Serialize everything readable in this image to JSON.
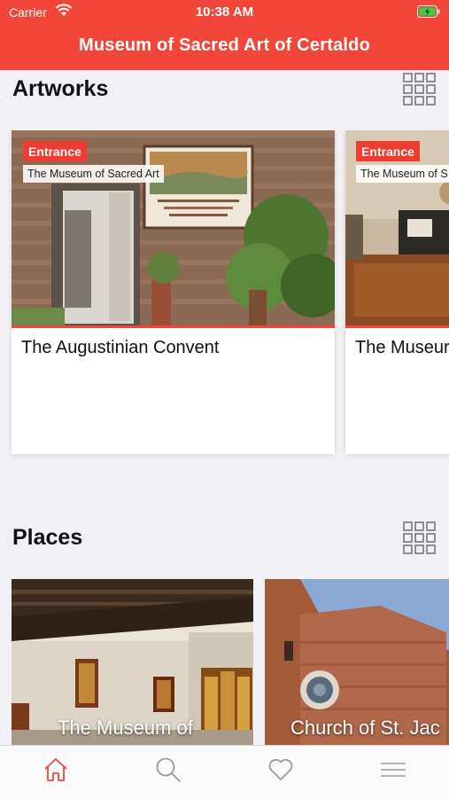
{
  "status_bar": {
    "carrier": "Carrier",
    "time": "10:38 AM"
  },
  "nav": {
    "title": "Museum of Sacred Art of Certaldo"
  },
  "artworks": {
    "title": "Artworks",
    "cards": [
      {
        "category": "Entrance",
        "location": "The Museum of Sacred Art",
        "title": "The Augustinian Convent"
      },
      {
        "category": "Entrance",
        "location": "The Museum of S",
        "title": "The Museur"
      }
    ]
  },
  "places": {
    "title": "Places",
    "cards": [
      {
        "title": "The Museum of"
      },
      {
        "title": "Church of St. Jac"
      }
    ]
  },
  "tabbar": {
    "items": [
      {
        "icon": "home-icon",
        "active": true
      },
      {
        "icon": "search-icon",
        "active": false
      },
      {
        "icon": "heart-icon",
        "active": false
      },
      {
        "icon": "menu-icon",
        "active": false
      }
    ]
  },
  "colors": {
    "accent": "#f2463b",
    "background": "#f1f0f5",
    "tab_inactive": "#9a9a9a"
  }
}
